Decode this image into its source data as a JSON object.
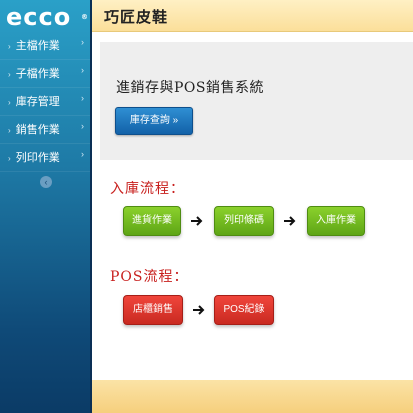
{
  "brand": {
    "logo_text": "ecco",
    "reg_mark": "®"
  },
  "sidebar": {
    "items": [
      {
        "label": "主檔作業"
      },
      {
        "label": "子檔作業"
      },
      {
        "label": "庫存管理"
      },
      {
        "label": "銷售作業"
      },
      {
        "label": "列印作業"
      }
    ],
    "collapse_icon": "‹"
  },
  "header": {
    "title": "巧匠皮鞋"
  },
  "hero": {
    "title": "進銷存與POS銷售系統",
    "button_label": "庫存查詢 »"
  },
  "inbound": {
    "label": "入庫流程：",
    "steps": [
      "進貨作業",
      "列印條碼",
      "入庫作業"
    ]
  },
  "pos": {
    "label": "POS流程：",
    "steps": [
      "店櫃銷售",
      "POS紀錄"
    ]
  },
  "colors": {
    "sidebar": "#1e7aa6",
    "header": "#fbdf9a",
    "accent_blue": "#1261a8",
    "flow_green": "#6bb51c",
    "flow_red": "#d8322a",
    "section_label": "#c8201e"
  }
}
